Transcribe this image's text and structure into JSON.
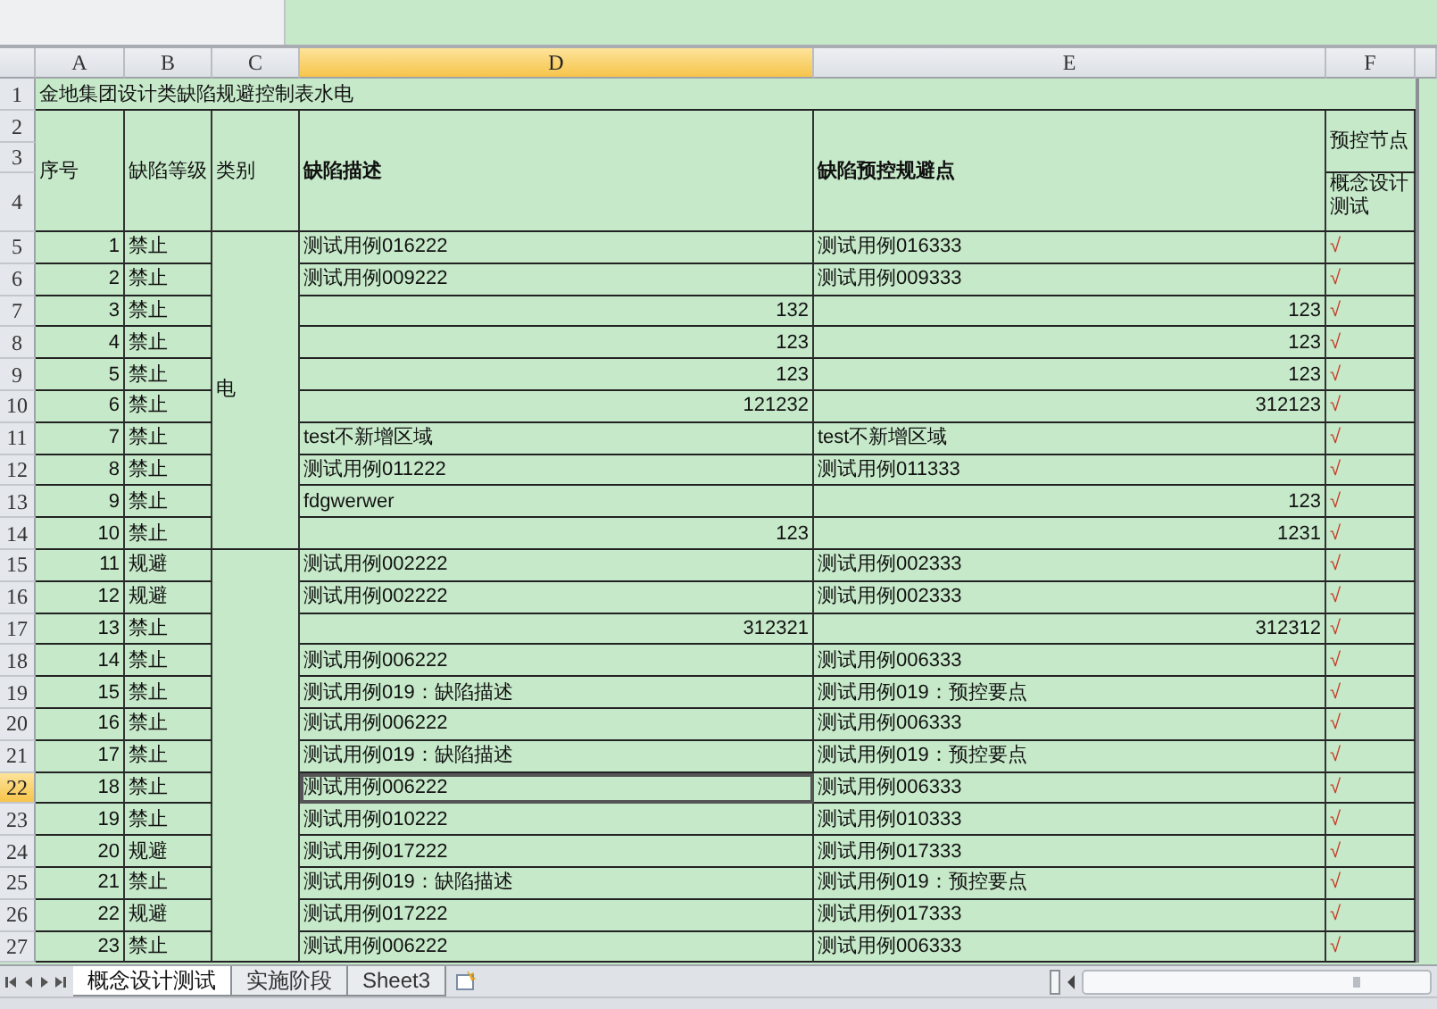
{
  "sheet": {
    "columns": [
      {
        "label": "A",
        "selected": false
      },
      {
        "label": "B",
        "selected": false
      },
      {
        "label": "C",
        "selected": false
      },
      {
        "label": "D",
        "selected": true
      },
      {
        "label": "E",
        "selected": false
      },
      {
        "label": "F",
        "selected": false
      }
    ],
    "row_headers": [
      {
        "label": "1",
        "selected": false
      },
      {
        "label": "2",
        "selected": false
      },
      {
        "label": "3",
        "selected": false
      },
      {
        "label": "4",
        "selected": false
      },
      {
        "label": "5",
        "selected": false
      },
      {
        "label": "6",
        "selected": false
      },
      {
        "label": "7",
        "selected": false
      },
      {
        "label": "8",
        "selected": false
      },
      {
        "label": "9",
        "selected": false
      },
      {
        "label": "10",
        "selected": false
      },
      {
        "label": "11",
        "selected": false
      },
      {
        "label": "12",
        "selected": false
      },
      {
        "label": "13",
        "selected": false
      },
      {
        "label": "14",
        "selected": false
      },
      {
        "label": "15",
        "selected": false
      },
      {
        "label": "16",
        "selected": false
      },
      {
        "label": "17",
        "selected": false
      },
      {
        "label": "18",
        "selected": false
      },
      {
        "label": "19",
        "selected": false
      },
      {
        "label": "20",
        "selected": false
      },
      {
        "label": "21",
        "selected": false
      },
      {
        "label": "22",
        "selected": true
      },
      {
        "label": "23",
        "selected": false
      },
      {
        "label": "24",
        "selected": false
      },
      {
        "label": "25",
        "selected": false
      },
      {
        "label": "26",
        "selected": false
      },
      {
        "label": "27",
        "selected": false
      }
    ],
    "title": "金地集团设计类缺陷规避控制表水电",
    "headers": {
      "seq": "序号",
      "level": "缺陷等级",
      "category": "类别",
      "description": "缺陷描述",
      "control": "缺陷预控规避点",
      "node": "预控节点",
      "node_sub": "概念设计测试"
    },
    "groups": [
      {
        "category": "电",
        "rows": [
          {
            "seq": "1",
            "level": "禁止",
            "description": {
              "text": "测试用例016222",
              "kind": "text"
            },
            "control": {
              "text": "测试用例016333",
              "kind": "text"
            },
            "mark": "√"
          },
          {
            "seq": "2",
            "level": "禁止",
            "description": {
              "text": "测试用例009222",
              "kind": "text"
            },
            "control": {
              "text": "测试用例009333",
              "kind": "text"
            },
            "mark": "√"
          },
          {
            "seq": "3",
            "level": "禁止",
            "description": {
              "text": "132",
              "kind": "number"
            },
            "control": {
              "text": "123",
              "kind": "number"
            },
            "mark": "√"
          },
          {
            "seq": "4",
            "level": "禁止",
            "description": {
              "text": "123",
              "kind": "number"
            },
            "control": {
              "text": "123",
              "kind": "number"
            },
            "mark": "√"
          },
          {
            "seq": "5",
            "level": "禁止",
            "description": {
              "text": "123",
              "kind": "number"
            },
            "control": {
              "text": "123",
              "kind": "number"
            },
            "mark": "√"
          },
          {
            "seq": "6",
            "level": "禁止",
            "description": {
              "text": "121232",
              "kind": "number"
            },
            "control": {
              "text": "312123",
              "kind": "number"
            },
            "mark": "√"
          },
          {
            "seq": "7",
            "level": "禁止",
            "description": {
              "text": "test不新增区域",
              "kind": "text"
            },
            "control": {
              "text": "test不新增区域",
              "kind": "text"
            },
            "mark": "√"
          },
          {
            "seq": "8",
            "level": "禁止",
            "description": {
              "text": "测试用例011222",
              "kind": "text"
            },
            "control": {
              "text": "测试用例011333",
              "kind": "text"
            },
            "mark": "√"
          },
          {
            "seq": "9",
            "level": "禁止",
            "description": {
              "text": "fdgwerwer",
              "kind": "text"
            },
            "control": {
              "text": "123",
              "kind": "number"
            },
            "mark": "√"
          },
          {
            "seq": "10",
            "level": "禁止",
            "description": {
              "text": "123",
              "kind": "number"
            },
            "control": {
              "text": "1231",
              "kind": "number"
            },
            "mark": "√"
          }
        ]
      },
      {
        "rows": [
          {
            "seq": "11",
            "level": "规避",
            "description": {
              "text": "测试用例002222",
              "kind": "text"
            },
            "control": {
              "text": "测试用例002333",
              "kind": "text"
            },
            "mark": "√"
          },
          {
            "seq": "12",
            "level": "规避",
            "description": {
              "text": "测试用例002222",
              "kind": "text"
            },
            "control": {
              "text": "测试用例002333",
              "kind": "text"
            },
            "mark": "√"
          },
          {
            "seq": "13",
            "level": "禁止",
            "description": {
              "text": "312321",
              "kind": "number"
            },
            "control": {
              "text": "312312",
              "kind": "number"
            },
            "mark": "√"
          },
          {
            "seq": "14",
            "level": "禁止",
            "description": {
              "text": "测试用例006222",
              "kind": "text"
            },
            "control": {
              "text": "测试用例006333",
              "kind": "text"
            },
            "mark": "√"
          },
          {
            "seq": "15",
            "level": "禁止",
            "description": {
              "text": "测试用例019：缺陷描述",
              "kind": "text"
            },
            "control": {
              "text": "测试用例019：预控要点",
              "kind": "text"
            },
            "mark": "√"
          },
          {
            "seq": "16",
            "level": "禁止",
            "description": {
              "text": "测试用例006222",
              "kind": "text"
            },
            "control": {
              "text": "测试用例006333",
              "kind": "text"
            },
            "mark": "√"
          },
          {
            "seq": "17",
            "level": "禁止",
            "description": {
              "text": "测试用例019：缺陷描述",
              "kind": "text"
            },
            "control": {
              "text": "测试用例019：预控要点",
              "kind": "text"
            },
            "mark": "√"
          },
          {
            "seq": "18",
            "level": "禁止",
            "description": {
              "text": "测试用例006222",
              "kind": "text"
            },
            "control": {
              "text": "测试用例006333",
              "kind": "text"
            },
            "mark": "√"
          },
          {
            "seq": "19",
            "level": "禁止",
            "description": {
              "text": "测试用例010222",
              "kind": "text"
            },
            "control": {
              "text": "测试用例010333",
              "kind": "text"
            },
            "mark": "√"
          },
          {
            "seq": "20",
            "level": "规避",
            "description": {
              "text": "测试用例017222",
              "kind": "text"
            },
            "control": {
              "text": "测试用例017333",
              "kind": "text"
            },
            "mark": "√"
          },
          {
            "seq": "21",
            "level": "禁止",
            "description": {
              "text": "测试用例019：缺陷描述",
              "kind": "text"
            },
            "control": {
              "text": "测试用例019：预控要点",
              "kind": "text"
            },
            "mark": "√"
          },
          {
            "seq": "22",
            "level": "规避",
            "description": {
              "text": "测试用例017222",
              "kind": "text"
            },
            "control": {
              "text": "测试用例017333",
              "kind": "text"
            },
            "mark": "√"
          },
          {
            "seq": "23",
            "level": "禁止",
            "description": {
              "text": "测试用例006222",
              "kind": "text"
            },
            "control": {
              "text": "测试用例006333",
              "kind": "text"
            },
            "mark": "√"
          }
        ]
      }
    ]
  },
  "tabs": [
    {
      "label": "概念设计测试",
      "selected": true
    },
    {
      "label": "实施阶段",
      "selected": false
    },
    {
      "label": "Sheet3",
      "selected": false
    }
  ]
}
